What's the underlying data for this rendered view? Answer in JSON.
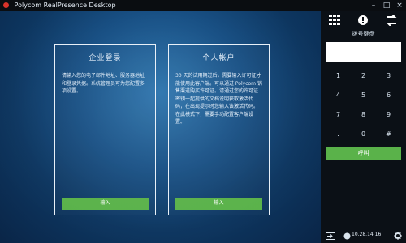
{
  "window": {
    "title": "Polycom RealPresence Desktop",
    "buttons": [
      "–",
      "□",
      "×"
    ]
  },
  "cards": [
    {
      "title": "企业登录",
      "body": "请输入您的电子邮件地址、服务器地址和登录凭据。系统管理员可为您配置多项设置。",
      "button_label": "输入"
    },
    {
      "title": "个人帐户",
      "body": "30 天的试用期过后，需要输入许可证才能使用此客户端。可以通过 Polycom 销售渠道购买许可证。请通过您的许可证密钥一起提供的文档说明获取激活代码，在出现提示时您输入该激活代码。在此模式下，需要手动配置客户端设置。",
      "button_label": "输入"
    }
  ],
  "sidebar": {
    "tabs": [
      "dialpad-icon",
      "contacts-icon",
      "calls-icon"
    ],
    "keypad_title": "拨号键盘",
    "dial_input_value": "",
    "keys": [
      "1",
      "2",
      "3",
      "4",
      "5",
      "6",
      "7",
      "8",
      "9",
      ".",
      "0",
      "#"
    ],
    "call_label": "呼叫",
    "ip_address": "10.28.14.16"
  }
}
